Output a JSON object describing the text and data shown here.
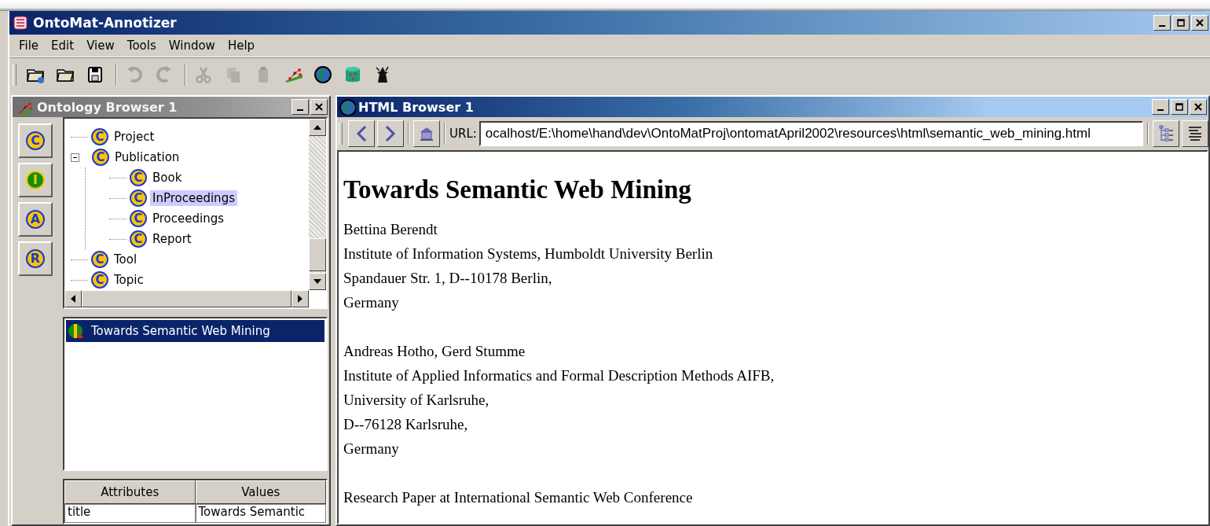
{
  "window": {
    "title": "OntoMat-Annotizer"
  },
  "menu": [
    "File",
    "Edit",
    "View",
    "Tools",
    "Window",
    "Help"
  ],
  "toolbar": [
    [
      {
        "kind": "open-web",
        "disabled": false
      },
      {
        "kind": "open",
        "disabled": false
      },
      {
        "kind": "save",
        "disabled": false
      }
    ],
    [
      {
        "kind": "undo",
        "disabled": true
      },
      {
        "kind": "redo",
        "disabled": true
      }
    ],
    [
      {
        "kind": "cut",
        "disabled": true
      },
      {
        "kind": "copy",
        "disabled": true
      },
      {
        "kind": "paste",
        "disabled": true
      },
      {
        "kind": "ontology",
        "disabled": false
      },
      {
        "kind": "globe",
        "disabled": false
      },
      {
        "kind": "database",
        "disabled": false
      },
      {
        "kind": "wizard",
        "disabled": false
      }
    ]
  ],
  "ontology_browser": {
    "title": "Ontology Browser 1",
    "active": false,
    "mode_buttons": [
      {
        "label": "C",
        "kind": "concept"
      },
      {
        "label": "I",
        "kind": "instance"
      },
      {
        "label": "A",
        "kind": "attribute"
      },
      {
        "label": "R",
        "kind": "relation"
      }
    ],
    "tree": [
      {
        "icon": "C",
        "label": "Project",
        "selected": false
      },
      {
        "icon": "C",
        "label": "Publication",
        "selected": false,
        "expanded": true,
        "children": [
          {
            "icon": "C",
            "label": "Book",
            "selected": false
          },
          {
            "icon": "C",
            "label": "InProceedings",
            "selected": true
          },
          {
            "icon": "C",
            "label": "Proceedings",
            "selected": false
          },
          {
            "icon": "C",
            "label": "Report",
            "selected": false
          }
        ]
      },
      {
        "icon": "C",
        "label": "Tool",
        "selected": false
      },
      {
        "icon": "C",
        "label": "Topic",
        "selected": false
      }
    ],
    "instances": [
      {
        "label": "Towards Semantic Web Mining",
        "selected": true
      }
    ],
    "attributes": {
      "columns": [
        "Attributes",
        "Values"
      ],
      "rows": [
        [
          "title",
          "Towards Semantic"
        ]
      ]
    }
  },
  "html_browser": {
    "title": "HTML Browser 1",
    "active": true,
    "url_label": "URL:",
    "url": "ocalhost/E:\\home\\hand\\dev\\OntoMatProj\\ontomatApril2002\\resources\\html\\semantic_web_mining.html",
    "heading": "Towards Semantic Web Mining",
    "paragraphs": [
      [
        "Bettina Berendt",
        "Institute of Information Systems, Humboldt University Berlin",
        "Spandauer Str. 1, D--10178 Berlin,",
        "Germany"
      ],
      [
        "Andreas Hotho, Gerd Stumme",
        "Institute of Applied Informatics and Formal Description Methods AIFB,",
        "University of Karlsruhe,",
        "D--76128 Karlsruhe,",
        "Germany"
      ],
      [
        "Research Paper at International Semantic Web Conference"
      ]
    ]
  }
}
